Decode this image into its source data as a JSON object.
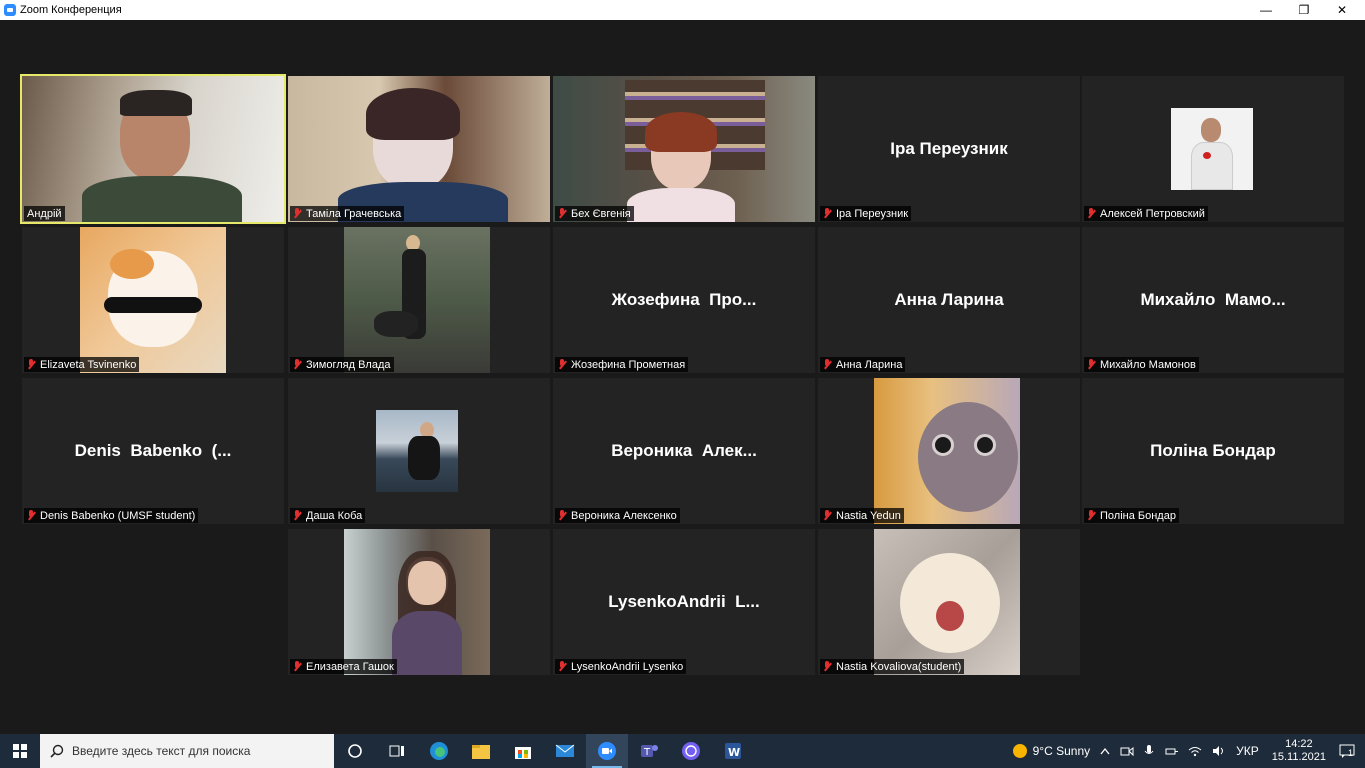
{
  "window": {
    "title": "Zoom Конференция",
    "controls": [
      "—",
      "❐",
      "✕"
    ]
  },
  "tiles": [
    {
      "name": "Андрій",
      "big": "",
      "video": "photo",
      "active": true
    },
    {
      "name": "Таміла Грачевська",
      "big": "",
      "video": "photo"
    },
    {
      "name": "Бех Євгенія",
      "big": "",
      "video": "photo"
    },
    {
      "name": "Іра Переузник",
      "big": "Іра Переузник",
      "video": "none"
    },
    {
      "name": "Алексей Петровский",
      "big": "",
      "video": "avatar"
    },
    {
      "name": "Elizaveta Tsvinenko",
      "big": "",
      "video": "avatar"
    },
    {
      "name": "Зимогляд Влада",
      "big": "",
      "video": "avatar"
    },
    {
      "name": "Жозефина Прометная",
      "big": "Жозефина  Про...",
      "video": "none"
    },
    {
      "name": "Анна Ларина",
      "big": "Анна Ларина",
      "video": "none"
    },
    {
      "name": "Михайло Мамонов",
      "big": "Михайло  Мамо...",
      "video": "none"
    },
    {
      "name": "Denis Babenko (UMSF student)",
      "big": "Denis  Babenko  (...",
      "video": "none"
    },
    {
      "name": "Даша Коба",
      "big": "",
      "video": "avatar"
    },
    {
      "name": "Вероника Алексенко",
      "big": "Вероника  Алек...",
      "video": "none"
    },
    {
      "name": "Nastia Yedun",
      "big": "",
      "video": "avatar"
    },
    {
      "name": "Поліна Бондар",
      "big": "Поліна Бондар",
      "video": "none"
    },
    {
      "name": "Елизавета Гашок",
      "big": "",
      "video": "avatar"
    },
    {
      "name": "LysenkoAndrii Lysenko",
      "big": "LysenkoAndrii  L...",
      "video": "none"
    },
    {
      "name": "Nastia Kovaliova(student)",
      "big": "",
      "video": "avatar"
    }
  ],
  "taskbar": {
    "search_placeholder": "Введите здесь текст для поиска",
    "weather": "9°C  Sunny",
    "language": "УКР",
    "time": "14:22",
    "date": "15.11.2021",
    "notifications": "1"
  },
  "colors": {
    "active_speaker": "#e6e86a",
    "muted_mic": "#e02f2f",
    "taskbar": "#1e2b3a"
  }
}
